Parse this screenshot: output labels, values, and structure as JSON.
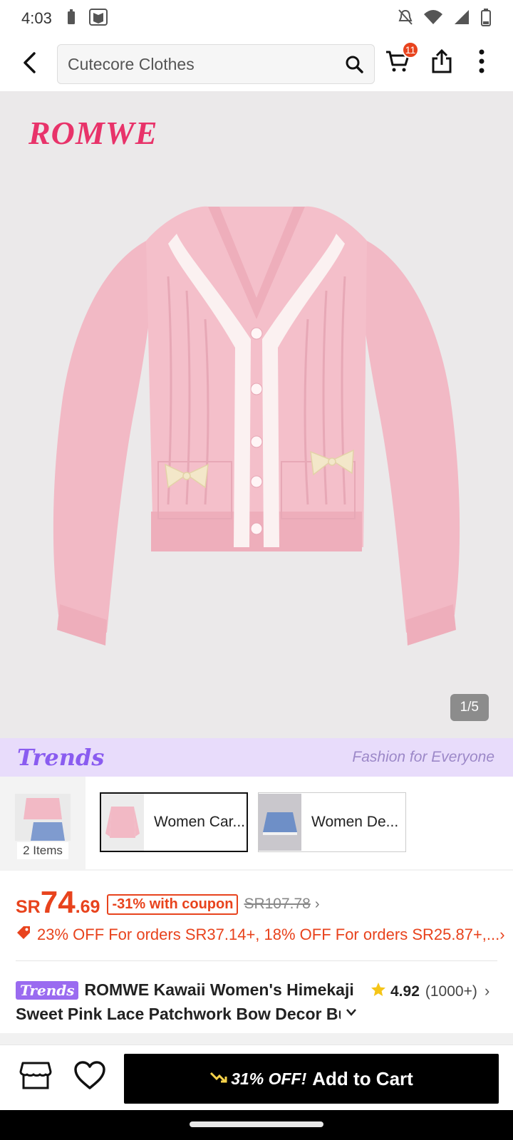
{
  "status_bar": {
    "time": "4:03",
    "icons": [
      "battery-saver-icon",
      "notification-icon",
      "mute-icon",
      "wifi-icon",
      "signal-icon",
      "battery-icon"
    ]
  },
  "top_nav": {
    "search_text": "Cutecore Clothes",
    "cart_count": "11",
    "icons": [
      "back-arrow-icon",
      "search-icon",
      "cart-icon",
      "share-icon",
      "more-vertical-icon"
    ]
  },
  "product_image": {
    "brand": "ROMWE",
    "counter": "1/5",
    "colors": {
      "background": "#ebe9ea",
      "cardigan": "#f3bdc8",
      "lace": "#fbf1f1",
      "bow": "#f3e7c9"
    }
  },
  "trends_banner": {
    "logo": "Trends",
    "tagline": "Fashion for Everyone"
  },
  "variants": {
    "all_label": "2 Items",
    "items": [
      {
        "label": "Women Car...",
        "selected": true
      },
      {
        "label": "Women De...",
        "selected": false
      }
    ]
  },
  "price": {
    "currency": "SR",
    "integer": "74",
    "decimal": ".69",
    "coupon": "-31% with coupon",
    "original": "SR107.78",
    "promo": "23% OFF For orders SR37.14+,  18% OFF For orders SR25.87+,..."
  },
  "title": {
    "badge": "Trends",
    "line1": "ROMWE Kawaii Women's Himekaji",
    "line2": "Sweet Pink Lace Patchwork Bow Decor Bu",
    "rating": "4.92",
    "review_count": "(1000+)"
  },
  "action_bar": {
    "discount": "31% OFF!",
    "add_to_cart": "Add to Cart"
  },
  "colors": {
    "accent": "#e8431d",
    "trends_purple": "#9a6bf0",
    "star": "#f5c518",
    "button_bg": "#000000"
  }
}
